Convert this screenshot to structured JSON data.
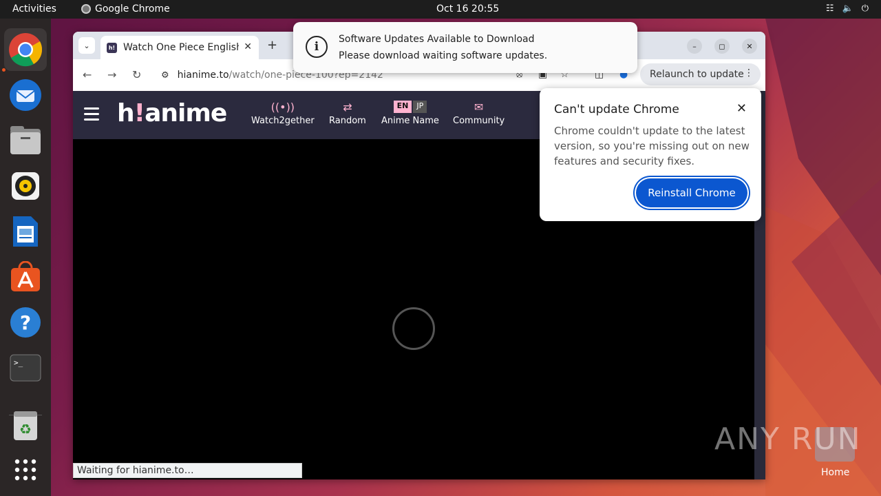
{
  "topbar": {
    "activities": "Activities",
    "app_name": "Google Chrome",
    "clock": "Oct 16  20:55",
    "tray_icons": [
      "network-icon",
      "volume-icon",
      "power-icon"
    ]
  },
  "dock": {
    "items": [
      "chrome-icon",
      "thunderbird-icon",
      "files-icon",
      "rhythmbox-icon",
      "writer-icon",
      "app-center-icon",
      "help-icon",
      "terminal-icon",
      "trash-icon",
      "show-apps-icon"
    ]
  },
  "browser": {
    "tab_title": "Watch One Piece English",
    "tab_favicon": "h!",
    "url_host": "hianime.to",
    "url_path": "/watch/one-piece-100?ep=2142",
    "relaunch_label": "Relaunch to update",
    "status_text": "Waiting for hianime.to…"
  },
  "site": {
    "logo_main": "h",
    "logo_bang": "!",
    "logo_rest": "anime",
    "nav": {
      "watch2gether": "Watch2gether",
      "random": "Random",
      "anime_name": "Anime Name",
      "community": "Community",
      "lang_en": "EN",
      "lang_jp": "JP"
    }
  },
  "notification": {
    "title": "Software Updates Available to Download",
    "body": "Please download waiting software updates."
  },
  "popup": {
    "title": "Can't update Chrome",
    "body": "Chrome couldn't update to the latest version, so you're missing out on new features and security fixes.",
    "button": "Reinstall Chrome"
  },
  "desktop": {
    "watermark": "ANY RUN",
    "home_label": "Home"
  },
  "colors": {
    "accent": "#0b57d0",
    "site_header": "#2b2a3e",
    "site_pink": "#ffb3d0",
    "ubuntu_orange": "#e95420"
  }
}
